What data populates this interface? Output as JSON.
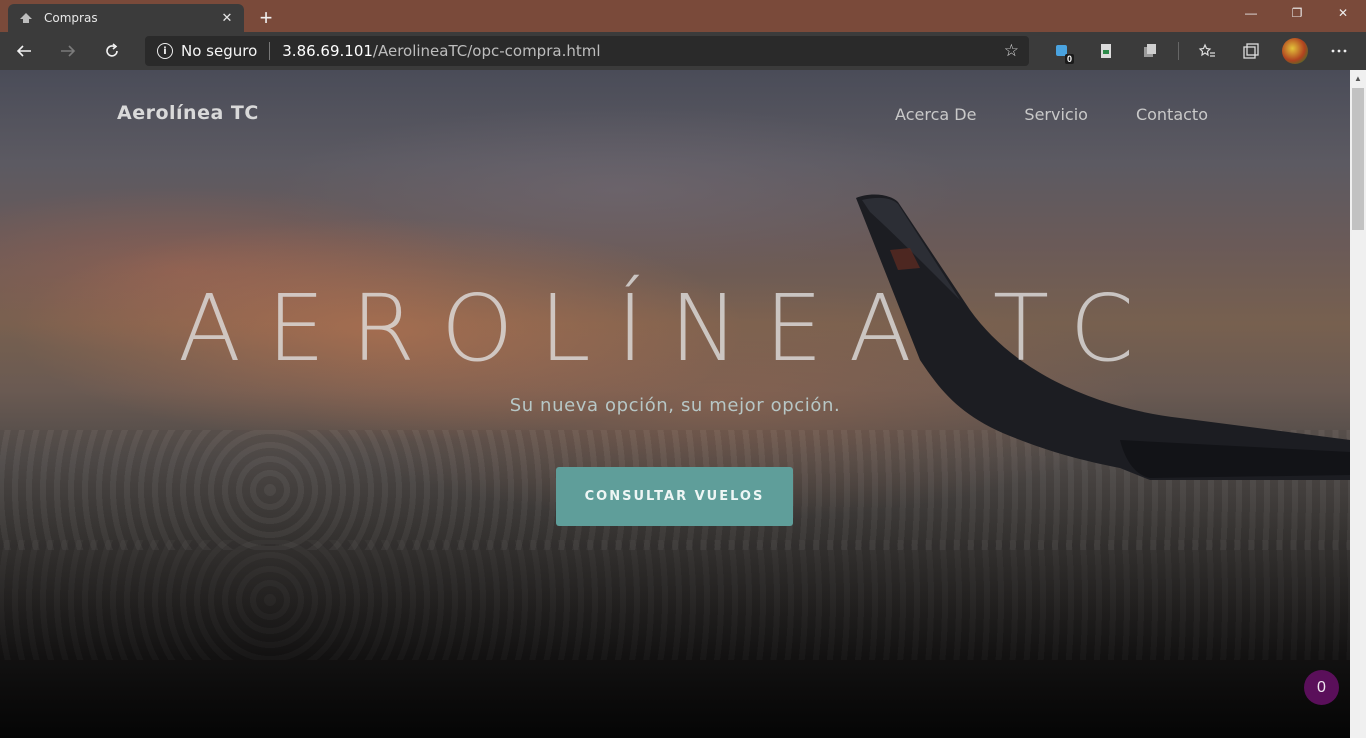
{
  "browser": {
    "tab": {
      "title": "Compras",
      "favicon": "page-favicon-icon",
      "close_icon": "✕"
    },
    "new_tab_icon": "+",
    "window_controls": {
      "minimize": "—",
      "restore": "❐",
      "close": "✕"
    },
    "nav": {
      "back": "back-arrow-icon",
      "forward": "forward-arrow-icon",
      "reload": "reload-icon"
    },
    "address": {
      "security_label": "No seguro",
      "host": "3.86.69.101",
      "path": "/AerolineaTC/opc-compra.html"
    },
    "extensions": {
      "badge_count": "0"
    },
    "colors": {
      "titlebar": "#7a4a3a",
      "toolbar": "#3b3b3b"
    }
  },
  "page": {
    "brand": "Aerolínea TC",
    "nav_links": [
      "Acerca De",
      "Servicio",
      "Contacto"
    ],
    "hero_title": "AEROLÍNEA TC",
    "hero_subtitle": "Su nueva opción, su mejor opción.",
    "cta_label": "CONSULTAR VUELOS",
    "floating_counter": "0",
    "colors": {
      "cta": "#5f9e9a",
      "counter_badge": "#5a0f5a"
    }
  }
}
